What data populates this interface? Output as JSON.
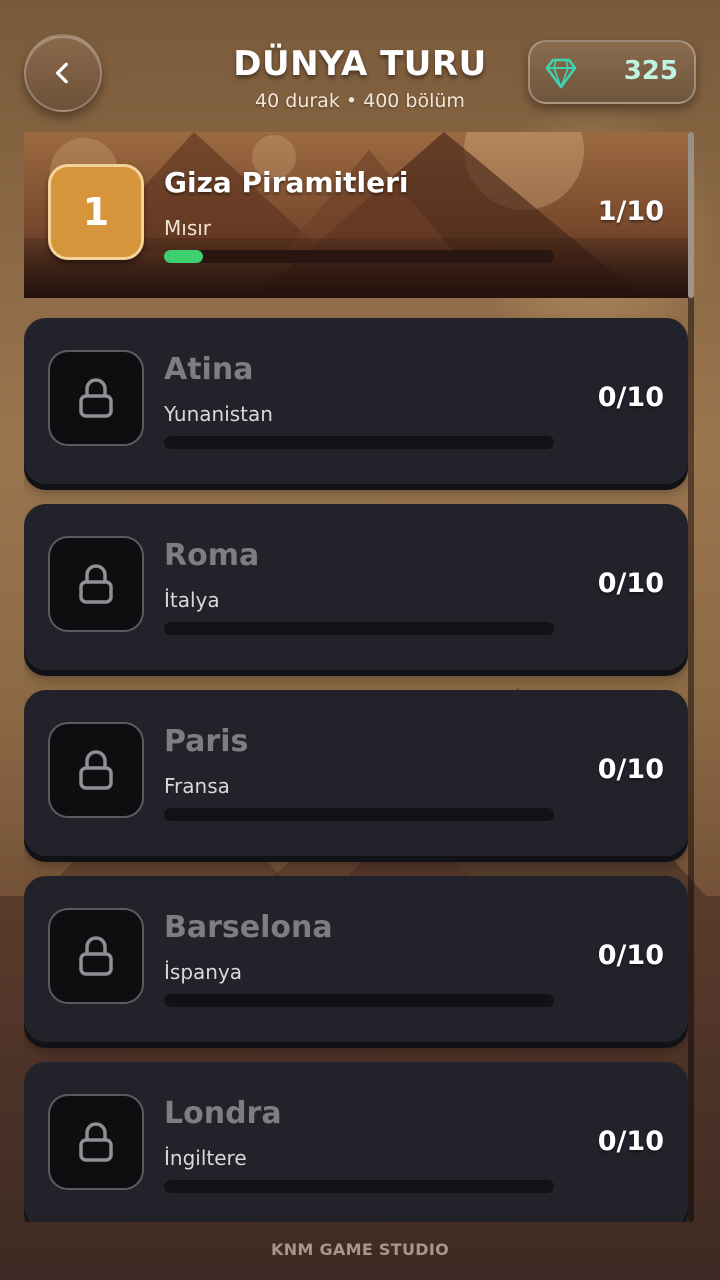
{
  "header": {
    "title": "DÜNYA TURU",
    "subtitle": "40 durak • 400 bölüm",
    "gems": "325",
    "back_icon": "chevron-left-icon",
    "gem_icon": "diamond-icon"
  },
  "colors": {
    "gem": "#3fd4b0",
    "progress": "#3fcf6e",
    "active_badge": "#d6953a",
    "locked_card": "#22222a"
  },
  "stops": [
    {
      "number": "1",
      "name": "Giza Piramitleri",
      "country": "Mısır",
      "score": "1/10",
      "progress": 0.1,
      "locked": false
    },
    {
      "name": "Atina",
      "country": "Yunanistan",
      "score": "0/10",
      "progress": 0,
      "locked": true
    },
    {
      "name": "Roma",
      "country": "İtalya",
      "score": "0/10",
      "progress": 0,
      "locked": true
    },
    {
      "name": "Paris",
      "country": "Fransa",
      "score": "0/10",
      "progress": 0,
      "locked": true
    },
    {
      "name": "Barselona",
      "country": "İspanya",
      "score": "0/10",
      "progress": 0,
      "locked": true
    },
    {
      "name": "Londra",
      "country": "İngiltere",
      "score": "0/10",
      "progress": 0,
      "locked": true
    }
  ],
  "footer": {
    "studio": "KNM GAME STUDIO"
  }
}
